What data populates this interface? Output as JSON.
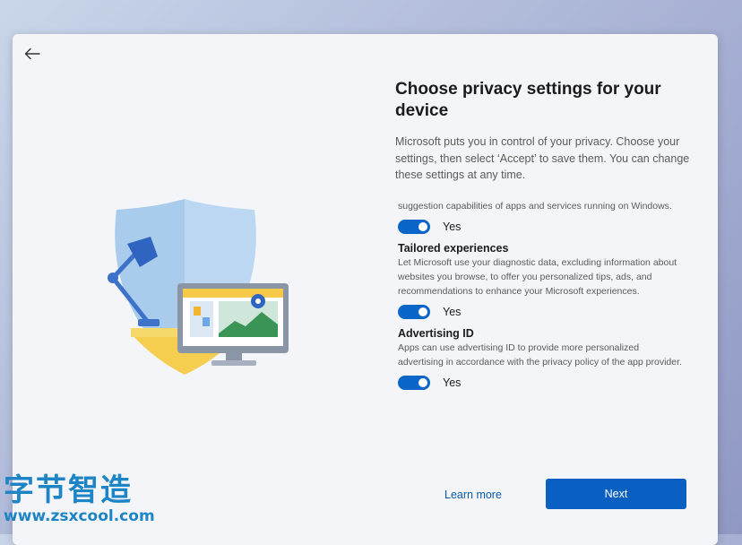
{
  "header": {
    "title": "Choose privacy settings for your device",
    "description": "Microsoft puts you in control of your privacy. Choose your settings, then select ‘Accept’ to save them. You can change these settings at any time."
  },
  "settings": {
    "partial_desc": "suggestion capabilities of apps and services running on Windows.",
    "partial_toggle": "Yes",
    "tailored": {
      "title": "Tailored experiences",
      "desc": "Let Microsoft use your diagnostic data, excluding information about websites you browse, to offer you personalized tips, ads, and recommendations to enhance your Microsoft experiences.",
      "toggle": "Yes"
    },
    "advertising": {
      "title": "Advertising ID",
      "desc": "Apps can use advertising ID to provide more personalized advertising in accordance with the privacy policy of the app provider.",
      "toggle": "Yes"
    }
  },
  "footer": {
    "learn_more": "Learn more",
    "next": "Next"
  },
  "watermark": {
    "chinese": "字节智造",
    "url": "www.zsxcool.com"
  },
  "colors": {
    "accent": "#0a5fc2",
    "toggle_on": "#0c66c9",
    "link": "#0a5aa8"
  }
}
